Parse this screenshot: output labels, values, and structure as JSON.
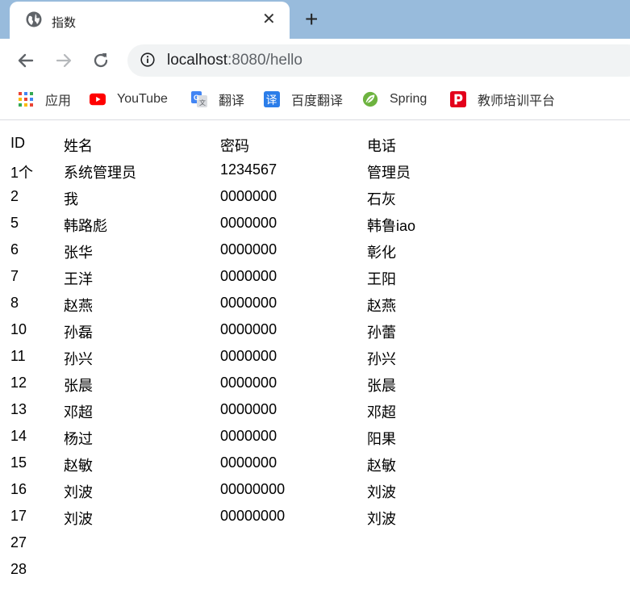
{
  "browser": {
    "tab_title": "指数",
    "url_host": "localhost",
    "url_rest": ":8080/hello"
  },
  "bookmarks": [
    {
      "label": "应用",
      "icon": "apps-grid-icon"
    },
    {
      "label": "YouTube",
      "icon": "youtube-icon"
    },
    {
      "label": "翻译",
      "icon": "google-translate-icon"
    },
    {
      "label": "百度翻译",
      "icon": "baidu-translate-icon"
    },
    {
      "label": "Spring",
      "icon": "spring-leaf-icon"
    },
    {
      "label": "教师培训平台",
      "icon": "p-logo-icon"
    }
  ],
  "table": {
    "headers": [
      "ID",
      "姓名",
      "密码",
      "电话"
    ],
    "rows": [
      [
        "1个",
        "系统管理员",
        "1234567",
        "管理员"
      ],
      [
        "2",
        "我",
        "0000000",
        "石灰"
      ],
      [
        "5",
        "韩路彪",
        "0000000",
        "韩鲁iao"
      ],
      [
        "6",
        "张华",
        "0000000",
        "彰化"
      ],
      [
        "7",
        "王洋",
        "0000000",
        "王阳"
      ],
      [
        "8",
        "赵燕",
        "0000000",
        "赵燕"
      ],
      [
        "10",
        "孙磊",
        "0000000",
        "孙蕾"
      ],
      [
        "11",
        "孙兴",
        "0000000",
        "孙兴"
      ],
      [
        "12",
        "张晨",
        "0000000",
        "张晨"
      ],
      [
        "13",
        "邓超",
        "0000000",
        "邓超"
      ],
      [
        "14",
        "杨过",
        "0000000",
        "阳果"
      ],
      [
        "15",
        "赵敏",
        "0000000",
        "赵敏"
      ],
      [
        "16",
        "刘波",
        "00000000",
        "刘波"
      ],
      [
        "17",
        "刘波",
        "00000000",
        "刘波"
      ],
      [
        "27",
        "",
        "",
        ""
      ],
      [
        "28",
        "",
        "",
        ""
      ]
    ]
  }
}
